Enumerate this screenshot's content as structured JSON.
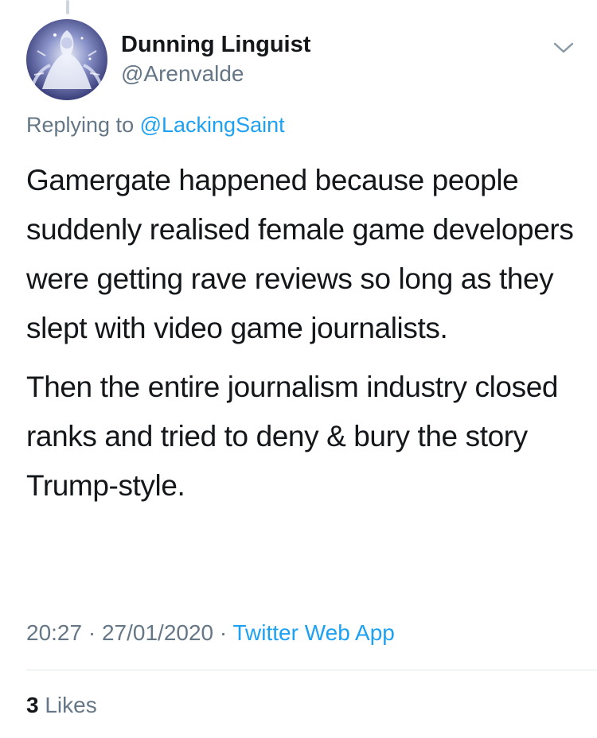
{
  "tweet": {
    "author": {
      "display_name": "Dunning Linguist",
      "handle": "@Arenvalde",
      "avatar_icon": "avatar-illustration-icon"
    },
    "reply": {
      "prefix": "Replying to ",
      "mention": "@LackingSaint"
    },
    "paragraphs": [
      "Gamergate happened because people suddenly realised female game developers were getting rave reviews so long as they slept with video game journalists.",
      "Then the entire journalism industry closed ranks and tried to deny & bury the story Trump-style."
    ],
    "meta": {
      "time": "20:27",
      "separator": " · ",
      "date": "27/01/2020",
      "source": "Twitter Web App"
    },
    "stats": {
      "likes_count": "3",
      "likes_label": " Likes"
    }
  },
  "colors": {
    "text": "#14171a",
    "secondary": "#657786",
    "accent": "#1da1f2",
    "divider": "#e1e8ed"
  }
}
